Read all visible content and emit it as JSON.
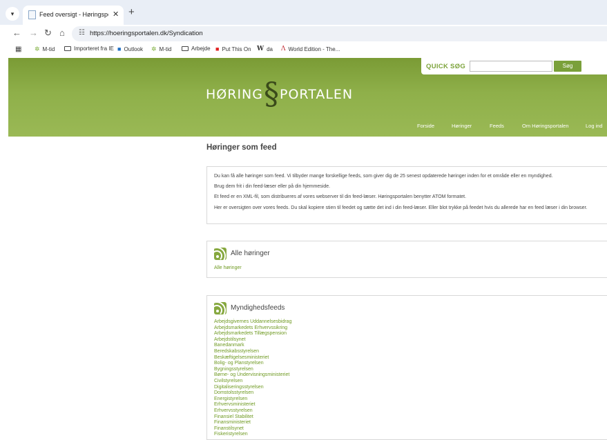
{
  "browser": {
    "tab_title": "Feed oversigt - Høringsportalen",
    "url": "https://hoeringsportalen.dk/Syndication",
    "bookmarks": [
      {
        "label": "M-tid",
        "icon": "app-icon"
      },
      {
        "label": "Importeret fra IE",
        "icon": "folder-icon"
      },
      {
        "label": "Outlook",
        "icon": "outlook-icon"
      },
      {
        "label": "M-tid",
        "icon": "app-icon"
      },
      {
        "label": "Arbejde",
        "icon": "folder-icon"
      },
      {
        "label": "Put This On",
        "icon": "red-square-icon"
      },
      {
        "label": "da",
        "icon": "wikipedia-icon"
      },
      {
        "label": "World Edition - The...",
        "icon": "ft-icon"
      }
    ]
  },
  "header": {
    "logo_left": "HØRING",
    "logo_mark": "§",
    "logo_right": "PORTALEN",
    "quick_search_label": "QUICK SØG",
    "search_button": "Søg",
    "nav": [
      "Forside",
      "Høringer",
      "Feeds",
      "Om Høringsportalen",
      "Log ind"
    ]
  },
  "main": {
    "title": "Høringer som feed",
    "intro": [
      "Du kan få alle høringer som feed. Vi tilbyder mange forskellige feeds, som giver dig de 25 senest opdaterede høringer inden for et område eller en myndighed.",
      "Brug dem frit i din feed-læser eller på din hjemmeside.",
      "Et feed er en XML-fil, som distribueres af vores webserver til din feed-læser. Høringsportalen benytter ATOM formatet.",
      "Her er oversigten over vores feeds. Du skal kopiere stien til feedet og sætte det ind i din feed-læser. Eller blot trykke på feedet hvis du allerede har en feed læser i din browser."
    ],
    "all_heading": "Alle høringer",
    "all_link": "Alle høringer",
    "authorities_heading": "Myndighedsfeeds",
    "authorities": [
      "Arbejdsgivernes Uddannelsesbidrag",
      "Arbejdsmarkedets Erhvervssikring",
      "Arbejdsmarkedets Tillægspension",
      "Arbejdstilsynet",
      "Banedanmark",
      "Beredskabsstyrelsen",
      "Beskæftigelsesministeriet",
      "Bolig- og Planstyrelsen",
      "Bygningsstyrelsen",
      "Børne- og Undervisningsministeriet",
      "Civilstyrelsen",
      "Digitaliseringsstyrelsen",
      "Domstolsstyrelsen",
      "Energistyrelsen",
      "Erhvervsministeriet",
      "Erhvervsstyrelsen",
      "Finansiel Stabilitet",
      "Finansministeriet",
      "Finanstilsynet",
      "Fiskeristyrelsen"
    ]
  }
}
